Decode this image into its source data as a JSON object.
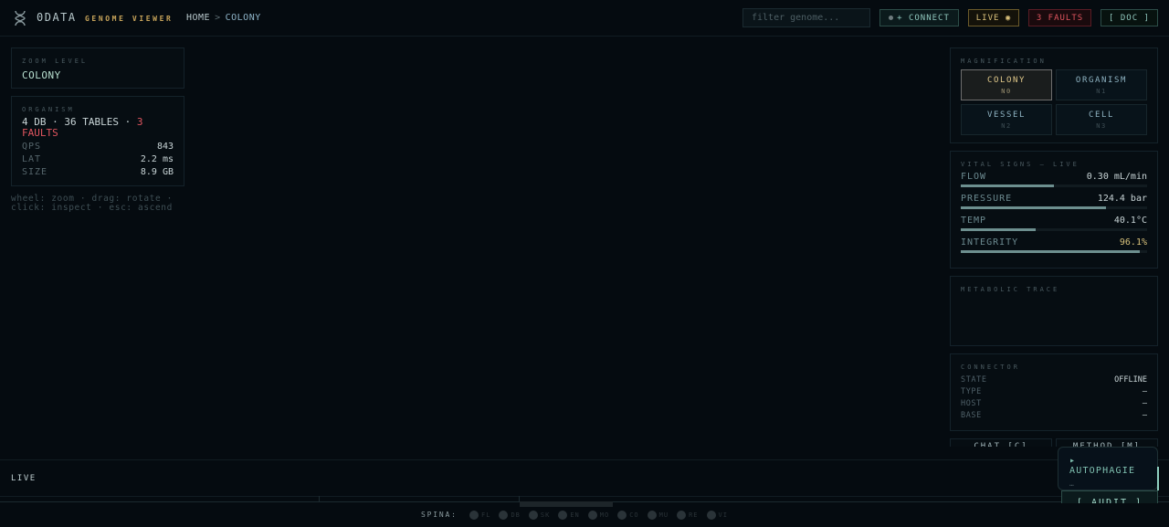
{
  "header": {
    "brand": "0DATA",
    "brand_sub": "GENOME VIEWER",
    "breadcrumb": {
      "home": "HOME",
      "sep": ">",
      "current": "COLONY"
    },
    "search_placeholder": "filter genome...",
    "connect_label": "+ CONNECT",
    "live_label": "LIVE ◉",
    "faults_label": "3 FAULTS",
    "doc_label": "[ DOC ]"
  },
  "zoom": {
    "title": "ZOOM LEVEL",
    "value": "COLONY"
  },
  "organism": {
    "title": "ORGANISM",
    "summary": "4 DB · 36 TABLES · ",
    "faults": "3 FAULTS",
    "stats": [
      {
        "key": "QPS",
        "value": "843"
      },
      {
        "key": "LAT",
        "value": "2.2 ms"
      },
      {
        "key": "SIZE",
        "value": "8.9 GB"
      }
    ]
  },
  "hint": "wheel: zoom · drag: rotate · click: inspect · esc: ascend",
  "magnification": {
    "title": "MAGNIFICATION",
    "levels": [
      {
        "label": "COLONY",
        "sub": "N0",
        "active": true
      },
      {
        "label": "ORGANISM",
        "sub": "N1",
        "active": false
      },
      {
        "label": "VESSEL",
        "sub": "N2",
        "active": false
      },
      {
        "label": "CELL",
        "sub": "N3",
        "active": false
      }
    ]
  },
  "vitals": {
    "title": "VITAL SIGNS — LIVE",
    "items": [
      {
        "key": "FLOW",
        "value": "0.30 mL/min",
        "level": 0.5,
        "warn": false
      },
      {
        "key": "PRESSURE",
        "value": "124.4 bar",
        "level": 0.78,
        "warn": false
      },
      {
        "key": "TEMP",
        "value": "40.1°C",
        "level": 0.4,
        "warn": false
      },
      {
        "key": "INTEGRITY",
        "value": "96.1%",
        "level": 0.961,
        "warn": true
      }
    ]
  },
  "trace": {
    "title": "METABOLIC TRACE"
  },
  "connector": {
    "title": "CONNECTOR",
    "rows": [
      {
        "key": "STATE",
        "value": "OFFLINE"
      },
      {
        "key": "TYPE",
        "value": "—"
      },
      {
        "key": "HOST",
        "value": "—"
      },
      {
        "key": "BASE",
        "value": "—"
      }
    ]
  },
  "cut_buttons": {
    "left": "CHAT [C]",
    "right": "METHOD [M]"
  },
  "live_bar": {
    "label": "LIVE"
  },
  "spine": {
    "label": "SPINA:",
    "items": [
      "FL",
      "DB",
      "SK",
      "EN",
      "MO",
      "CO",
      "MU",
      "RE",
      "VI"
    ]
  },
  "autophagie": {
    "title": "▸ AUTOPHAGIE",
    "sub": "…",
    "audit_label": "[ AUDIT ]"
  },
  "colors": {
    "accent_teal": "#8fc6bc",
    "accent_gold": "#d9c07a",
    "fault_red": "#e0555f",
    "background": "#050b10"
  }
}
